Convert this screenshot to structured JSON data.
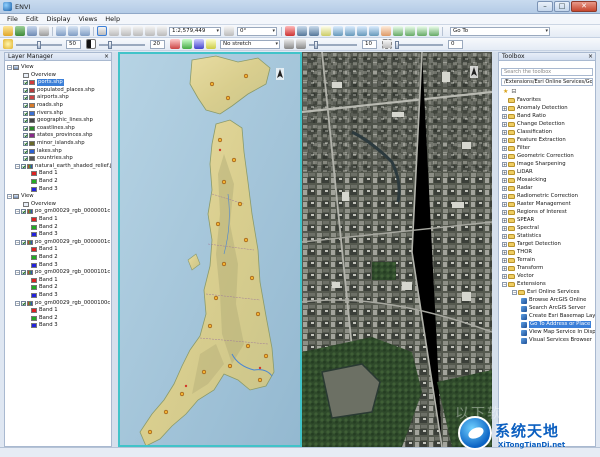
{
  "window": {
    "title": "ENVI",
    "buttons": [
      "–",
      "□",
      "✕"
    ]
  },
  "menu": [
    "File",
    "Edit",
    "Display",
    "Views",
    "Help"
  ],
  "toolbar": {
    "scale_value": "1:2,579,449",
    "rotation_value": "0°",
    "goto_label": "Go To",
    "brightness_value": "50",
    "contrast_value": "20",
    "stretch_value": "No stretch",
    "sharpen_value": "10",
    "transparency_value": "0"
  },
  "layer_manager": {
    "title": "Layer Manager",
    "rows": [
      {
        "label": "View",
        "level": 0,
        "kind": "view",
        "checked": false
      },
      {
        "label": "Overview",
        "level": 2,
        "kind": "plain",
        "checked": false
      },
      {
        "label": "ports.shp",
        "level": 2,
        "kind": "vector",
        "checked": true,
        "selected": true,
        "color": "#d13a3a"
      },
      {
        "label": "populated_places.shp",
        "level": 2,
        "kind": "vector",
        "checked": true,
        "color": "#b23a3a"
      },
      {
        "label": "airports.shp",
        "level": 2,
        "kind": "vector",
        "checked": true,
        "color": "#c44"
      },
      {
        "label": "roads.shp",
        "level": 2,
        "kind": "vector",
        "checked": true,
        "color": "#d77a2a"
      },
      {
        "label": "rivers.shp",
        "level": 2,
        "kind": "vector",
        "checked": true,
        "color": "#3a6fd1"
      },
      {
        "label": "geographic_lines.shp",
        "level": 2,
        "kind": "vector",
        "checked": true,
        "color": "#444"
      },
      {
        "label": "coastlines.shp",
        "level": 2,
        "kind": "vector",
        "checked": true,
        "color": "#2a8a2a"
      },
      {
        "label": "states_provinces.shp",
        "level": 2,
        "kind": "vector",
        "checked": true,
        "color": "#8a2a8a"
      },
      {
        "label": "minor_islands.shp",
        "level": 2,
        "kind": "vector",
        "checked": true,
        "color": "#6a6a2a"
      },
      {
        "label": "lakes.shp",
        "level": 2,
        "kind": "vector",
        "checked": true,
        "color": "#2a5fd1"
      },
      {
        "label": "countries.shp",
        "level": 2,
        "kind": "vector",
        "checked": true,
        "color": "#555"
      },
      {
        "label": "natural_earth_shaded_relief.jp",
        "level": 1,
        "kind": "raster",
        "checked": true
      },
      {
        "label": "Band 1",
        "level": 3,
        "kind": "band",
        "color": "#d22"
      },
      {
        "label": "Band 2",
        "level": 3,
        "kind": "band",
        "color": "#2a2"
      },
      {
        "label": "Band 3",
        "level": 3,
        "kind": "band",
        "color": "#22d"
      },
      {
        "label": "View",
        "level": 0,
        "kind": "view",
        "checked": false
      },
      {
        "label": "Overview",
        "level": 2,
        "kind": "plain",
        "checked": false
      },
      {
        "label": "po_gm00029_rgb_0000001c",
        "level": 1,
        "kind": "raster",
        "checked": true
      },
      {
        "label": "Band 1",
        "level": 3,
        "kind": "band",
        "color": "#d22"
      },
      {
        "label": "Band 2",
        "level": 3,
        "kind": "band",
        "color": "#2a2"
      },
      {
        "label": "Band 3",
        "level": 3,
        "kind": "band",
        "color": "#22d"
      },
      {
        "label": "po_gm00029_rgb_0000001c",
        "level": 1,
        "kind": "raster",
        "checked": true
      },
      {
        "label": "Band 1",
        "level": 3,
        "kind": "band",
        "color": "#d22"
      },
      {
        "label": "Band 2",
        "level": 3,
        "kind": "band",
        "color": "#2a2"
      },
      {
        "label": "Band 3",
        "level": 3,
        "kind": "band",
        "color": "#22d"
      },
      {
        "label": "po_gm00029_rgb_0000101c",
        "level": 1,
        "kind": "raster",
        "checked": true
      },
      {
        "label": "Band 1",
        "level": 3,
        "kind": "band",
        "color": "#d22"
      },
      {
        "label": "Band 2",
        "level": 3,
        "kind": "band",
        "color": "#2a2"
      },
      {
        "label": "Band 3",
        "level": 3,
        "kind": "band",
        "color": "#22d"
      },
      {
        "label": "po_gm00029_rgb_0000100c",
        "level": 1,
        "kind": "raster",
        "checked": true
      },
      {
        "label": "Band 1",
        "level": 3,
        "kind": "band",
        "color": "#d22"
      },
      {
        "label": "Band 2",
        "level": 3,
        "kind": "band",
        "color": "#2a2"
      },
      {
        "label": "Band 3",
        "level": 3,
        "kind": "band",
        "color": "#22d"
      }
    ]
  },
  "toolbox": {
    "title": "Toolbox",
    "search_placeholder": "Search the toolbox",
    "path": "/Extensions/Esri Online Services/Go To Addre",
    "items": [
      {
        "label": "Favorites",
        "level": 1,
        "kind": "folder",
        "expander": ""
      },
      {
        "label": "Anomaly Detection",
        "level": 1,
        "kind": "folder",
        "expander": "+"
      },
      {
        "label": "Band Ratio",
        "level": 1,
        "kind": "folder",
        "expander": "+"
      },
      {
        "label": "Change Detection",
        "level": 1,
        "kind": "folder",
        "expander": "+"
      },
      {
        "label": "Classification",
        "level": 1,
        "kind": "folder",
        "expander": "+"
      },
      {
        "label": "Feature Extraction",
        "level": 1,
        "kind": "folder",
        "expander": "+"
      },
      {
        "label": "Filter",
        "level": 1,
        "kind": "folder",
        "expander": "+"
      },
      {
        "label": "Geometric Correction",
        "level": 1,
        "kind": "folder",
        "expander": "+"
      },
      {
        "label": "Image Sharpening",
        "level": 1,
        "kind": "folder",
        "expander": "+"
      },
      {
        "label": "LiDAR",
        "level": 1,
        "kind": "folder",
        "expander": "+"
      },
      {
        "label": "Mosaicking",
        "level": 1,
        "kind": "folder",
        "expander": "+"
      },
      {
        "label": "Radar",
        "level": 1,
        "kind": "folder",
        "expander": "+"
      },
      {
        "label": "Radiometric Correction",
        "level": 1,
        "kind": "folder",
        "expander": "+"
      },
      {
        "label": "Raster Management",
        "level": 1,
        "kind": "folder",
        "expander": "+"
      },
      {
        "label": "Regions of Interest",
        "level": 1,
        "kind": "folder",
        "expander": "+"
      },
      {
        "label": "SPEAR",
        "level": 1,
        "kind": "folder",
        "expander": "+"
      },
      {
        "label": "Spectral",
        "level": 1,
        "kind": "folder",
        "expander": "+"
      },
      {
        "label": "Statistics",
        "level": 1,
        "kind": "folder",
        "expander": "+"
      },
      {
        "label": "Target Detection",
        "level": 1,
        "kind": "folder",
        "expander": "+"
      },
      {
        "label": "THOR",
        "level": 1,
        "kind": "folder",
        "expander": "+"
      },
      {
        "label": "Terrain",
        "level": 1,
        "kind": "folder",
        "expander": "+"
      },
      {
        "label": "Transform",
        "level": 1,
        "kind": "folder",
        "expander": "+"
      },
      {
        "label": "Vector",
        "level": 1,
        "kind": "folder",
        "expander": "+"
      },
      {
        "label": "Extensions",
        "level": 1,
        "kind": "folder",
        "expander": "−"
      },
      {
        "label": "Esri Online Services",
        "level": 2,
        "kind": "folder",
        "expander": "−"
      },
      {
        "label": "Browse ArcGIS Online",
        "level": 3,
        "kind": "tool",
        "expander": ""
      },
      {
        "label": "Search ArcGIS Server",
        "level": 3,
        "kind": "tool",
        "expander": ""
      },
      {
        "label": "Create Esri Basemap Layer",
        "level": 3,
        "kind": "tool",
        "expander": ""
      },
      {
        "label": "Go To Address or Place",
        "level": 3,
        "kind": "tool",
        "expander": "",
        "selected": true
      },
      {
        "label": "View Map Service In Display",
        "level": 3,
        "kind": "tool",
        "expander": ""
      },
      {
        "label": "Visual Services Browser",
        "level": 3,
        "kind": "tool",
        "expander": ""
      }
    ]
  },
  "watermark": {
    "title": "系统天地",
    "subtitle": "XiTongTianDi.net",
    "faint": "以下软件园"
  }
}
